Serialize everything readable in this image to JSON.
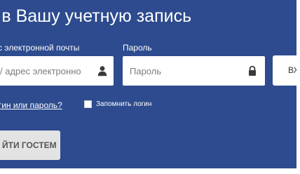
{
  "login": {
    "title": "ти в Вашу учетную запись",
    "login_label": "адрес электронной почты",
    "login_placeholder": "/ адрес электронно",
    "password_label": "Пароль",
    "password_placeholder": "Пароль",
    "enter_button": "ВХО",
    "forgot_link": "логин или пароль?",
    "remember_label": "Запомнить логин",
    "guest_button": "ЙТИ ГОСТЕМ"
  },
  "icons": {
    "login_field": "user-icon",
    "password_field": "lock-icon"
  },
  "colors": {
    "panel_bg": "#2d4b8e",
    "field_bg": "#ffffff",
    "guest_bg": "#e3e3e3",
    "text_light": "#ffffff"
  }
}
